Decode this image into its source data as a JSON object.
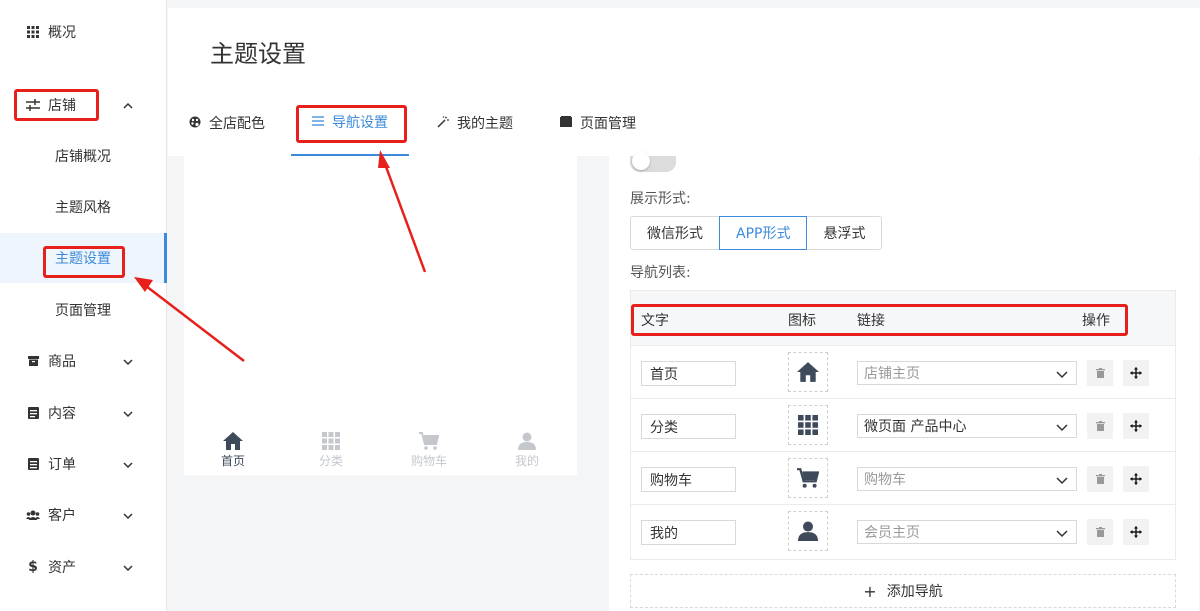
{
  "sidebar": {
    "overview": "概况",
    "store": "店铺",
    "store_sub": [
      "店铺概况",
      "主题风格",
      "主题设置",
      "页面管理"
    ],
    "goods": "商品",
    "content": "内容",
    "orders": "订单",
    "customers": "客户",
    "assets": "资产"
  },
  "header": {
    "title": "主题设置"
  },
  "tabs": [
    "全店配色",
    "导航设置",
    "我的主题",
    "页面管理"
  ],
  "preview": {
    "nav": [
      "首页",
      "分类",
      "购物车",
      "我的"
    ]
  },
  "panel": {
    "display_label": "展示形式:",
    "display_options": [
      "微信形式",
      "APP形式",
      "悬浮式"
    ],
    "display_selected": "APP形式",
    "list_label": "导航列表:",
    "columns": [
      "文字",
      "图标",
      "链接",
      "操作"
    ],
    "rows": [
      {
        "text": "首页",
        "icon": "home-icon",
        "link": "店铺主页"
      },
      {
        "text": "分类",
        "icon": "grid-icon",
        "link": "微页面 产品中心"
      },
      {
        "text": "购物车",
        "icon": "cart-icon",
        "link": "购物车"
      },
      {
        "text": "我的",
        "icon": "user-icon",
        "link": "会员主页"
      }
    ],
    "add_label": "添加导航",
    "add_symbol": "+"
  },
  "colors": {
    "accent": "#3c8ad9",
    "annotation": "#e8201b",
    "icon_dark": "#3e4a5a",
    "icon_muted": "#c4c8cd"
  }
}
